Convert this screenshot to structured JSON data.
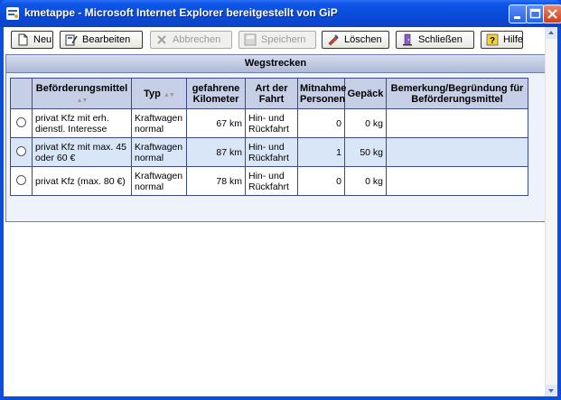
{
  "window": {
    "title": "kmetappe - Microsoft Internet Explorer bereitgestellt von GiP"
  },
  "toolbar": {
    "new_label": "Neu",
    "edit_label": "Bearbeiten",
    "cancel_label": "Abbrechen",
    "save_label": "Speichern",
    "delete_label": "Löschen",
    "close_label": "Schließen",
    "help_label": "Hilfe"
  },
  "panel": {
    "title": "Wegstrecken"
  },
  "table": {
    "headers": {
      "mittel": "Beförderungsmittel",
      "typ": "Typ",
      "km": "gefahrene Kilometer",
      "art": "Art der Fahrt",
      "personen": "Mitnahme Personen",
      "gepaeck": "Gepäck",
      "bemerkung": "Bemerkung/Begründung für Beförderungsmittel"
    },
    "rows": [
      {
        "mittel": "privat Kfz mit erh. dienstl. Interesse",
        "typ": "Kraftwagen normal",
        "km": "67 km",
        "art": "Hin- und Rückfahrt",
        "personen": "0",
        "gepaeck": "0 kg",
        "bemerkung": ""
      },
      {
        "mittel": "privat Kfz mit max. 45 oder 60 €",
        "typ": "Kraftwagen normal",
        "km": "87 km",
        "art": "Hin- und Rückfahrt",
        "personen": "1",
        "gepaeck": "50 kg",
        "bemerkung": ""
      },
      {
        "mittel": "privat Kfz (max. 80 €)",
        "typ": "Kraftwagen normal",
        "km": "78 km",
        "art": "Hin- und Rückfahrt",
        "personen": "0",
        "gepaeck": "0 kg",
        "bemerkung": ""
      }
    ]
  },
  "colors": {
    "titlebar": "#0a4ede",
    "header_row": "#c6cfe6",
    "selected_row": "#d9e6f8",
    "panel_border": "#6f7fa8"
  },
  "icons": [
    "ie-icon",
    "minimize-icon",
    "maximize-icon",
    "close-icon",
    "new-document-icon",
    "edit-icon",
    "cancel-icon",
    "save-icon",
    "delete-icon",
    "exit-icon",
    "help-icon",
    "sort-arrows-icon",
    "radio-icon"
  ]
}
